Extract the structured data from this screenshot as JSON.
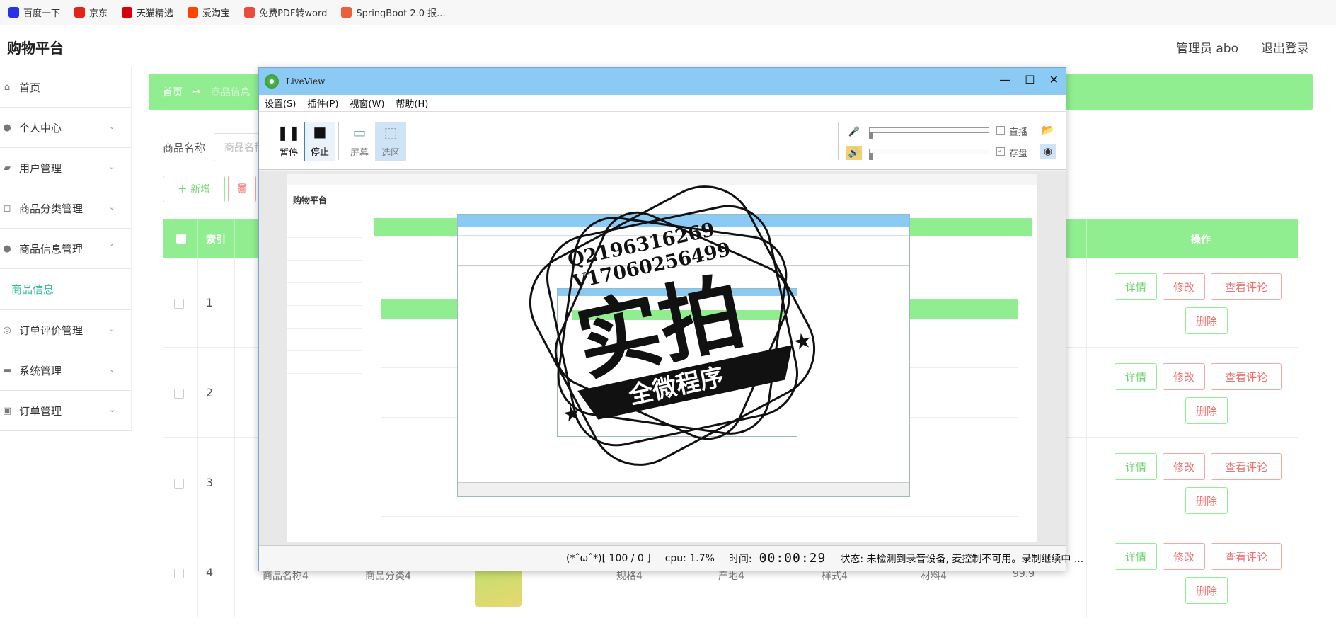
{
  "bookmarks": [
    {
      "label": "百度一下",
      "icon": "paw-icon",
      "color": "#2932e1"
    },
    {
      "label": "京东",
      "icon": "jd-icon",
      "color": "#e1251b"
    },
    {
      "label": "天猫精选",
      "icon": "tmall-icon",
      "color": "#d4000b"
    },
    {
      "label": "爱淘宝",
      "icon": "taobao-icon",
      "color": "#ff4400"
    },
    {
      "label": "免费PDF转word",
      "icon": "pdf-icon",
      "color": "#e84c3d"
    },
    {
      "label": "SpringBoot 2.0 报...",
      "icon": "juejin-icon",
      "color": "#e8603c"
    }
  ],
  "app": {
    "title": "购物平台",
    "admin": "管理员 abo",
    "logout": "退出登录"
  },
  "sidebar": {
    "items": [
      {
        "label": "首页",
        "icon": "home-icon"
      },
      {
        "label": "个人中心",
        "icon": "user-icon"
      },
      {
        "label": "用户管理",
        "icon": "users-icon"
      },
      {
        "label": "商品分类管理",
        "icon": "category-icon"
      },
      {
        "label": "商品信息管理",
        "icon": "product-icon"
      }
    ],
    "sub_item": "商品信息",
    "items_after": [
      {
        "label": "订单评价管理",
        "icon": "review-icon"
      },
      {
        "label": "系统管理",
        "icon": "chat-icon"
      },
      {
        "label": "订单管理",
        "icon": "order-icon"
      }
    ]
  },
  "breadcrumb": {
    "home": "首页",
    "arrow": "→",
    "current": "商品信息"
  },
  "search": {
    "label": "商品名称",
    "placeholder": "商品名称"
  },
  "buttons": {
    "add": "＋ 新增",
    "delete_partial": "🗑"
  },
  "table": {
    "header_index": "索引",
    "header_ops": "操作",
    "rows": [
      {
        "index": "1",
        "name": "",
        "category": "",
        "spec": "",
        "origin": "",
        "style": "",
        "material": "",
        "price": ""
      },
      {
        "index": "2",
        "name": "",
        "category": "",
        "spec": "",
        "origin": "",
        "style": "",
        "material": "",
        "price": ""
      },
      {
        "index": "3",
        "name": "",
        "category": "",
        "spec": "",
        "origin": "",
        "style": "",
        "material": "",
        "price": ""
      },
      {
        "index": "4",
        "name": "商品名称4",
        "category": "商品分类4",
        "spec": "规格4",
        "origin": "产地4",
        "style": "样式4",
        "material": "材料4",
        "price": "99.9"
      }
    ],
    "ops": {
      "detail": "详情",
      "edit": "修改",
      "comment": "查看评论",
      "delete": "删除"
    }
  },
  "liveview": {
    "title": "LiveView",
    "controls": {
      "minimize": "—",
      "maximize": "☐",
      "close": "✕"
    },
    "menu": [
      "设置(S)",
      "插件(P)",
      "视窗(W)",
      "帮助(H)"
    ],
    "toolbar": {
      "pause": "暂停",
      "stop": "停止",
      "screen": "屏幕",
      "region": "选区"
    },
    "audio": {
      "live": "直播",
      "save": "存盘"
    },
    "status": {
      "face": "(*ˆωˆ*)[ 100 / 0 ]",
      "cpu": "cpu: 1.7%",
      "time_label": "时间:",
      "time_value": "00:00:29",
      "state": "状态: 未检测到录音设备, 麦控制不可用。录制继续中 ..."
    }
  },
  "watermark": {
    "line1": "Q2196316269",
    "line2": "V17060256499",
    "main": "实拍",
    "banner": "全微程序"
  },
  "preview": {
    "title": "购物平台"
  }
}
